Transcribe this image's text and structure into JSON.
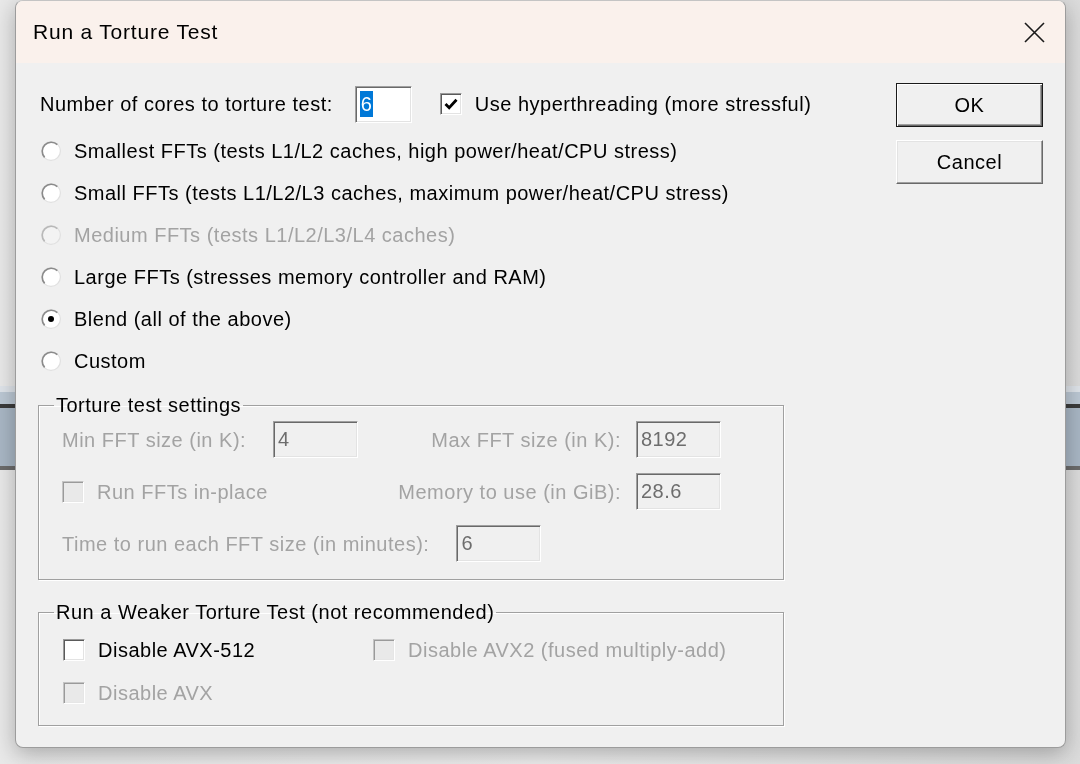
{
  "window": {
    "title": "Run a Torture Test"
  },
  "cores": {
    "label": "Number of cores to torture test:",
    "value": "6",
    "text_selected": true
  },
  "hyperthreading": {
    "label": "Use hyperthreading (more stressful)",
    "checked": true,
    "disabled": false
  },
  "test_types": [
    {
      "label": "Smallest FFTs (tests L1/L2 caches, high power/heat/CPU stress)",
      "selected": false,
      "disabled": false
    },
    {
      "label": "Small FFTs (tests L1/L2/L3 caches, maximum power/heat/CPU stress)",
      "selected": false,
      "disabled": false
    },
    {
      "label": "Medium FFTs (tests L1/L2/L3/L4 caches)",
      "selected": false,
      "disabled": true
    },
    {
      "label": "Large FFTs (stresses memory controller and RAM)",
      "selected": false,
      "disabled": false
    },
    {
      "label": "Blend (all of the above)",
      "selected": true,
      "disabled": false
    },
    {
      "label": "Custom",
      "selected": false,
      "disabled": false
    }
  ],
  "settings": {
    "title": "Torture test settings",
    "rows": [
      [
        {
          "kind": "field",
          "label": "Min FFT size (in K):",
          "value": "4",
          "disabled": true
        },
        {
          "kind": "field",
          "label": "Max FFT size (in K):",
          "value": "8192",
          "disabled": true
        }
      ],
      [
        {
          "kind": "checkbox",
          "label": "Run FFTs in-place",
          "checked": false,
          "disabled": true
        },
        {
          "kind": "field",
          "label": "Memory to use (in GiB):",
          "value": "28.6",
          "disabled": true
        }
      ],
      [
        {
          "kind": "field",
          "label": "Time to run each FFT size (in minutes):",
          "value": "6",
          "disabled": true
        }
      ]
    ]
  },
  "weaker_test": {
    "title": "Run a Weaker Torture Test (not recommended)",
    "options": [
      {
        "label": "Disable AVX-512",
        "checked": false,
        "disabled": false
      },
      {
        "label": "Disable AVX2 (fused multiply-add)",
        "checked": false,
        "disabled": true
      },
      {
        "label": "Disable AVX",
        "checked": false,
        "disabled": true
      }
    ]
  },
  "buttons": [
    {
      "label": "OK",
      "default": true
    },
    {
      "label": "Cancel",
      "default": false
    }
  ]
}
